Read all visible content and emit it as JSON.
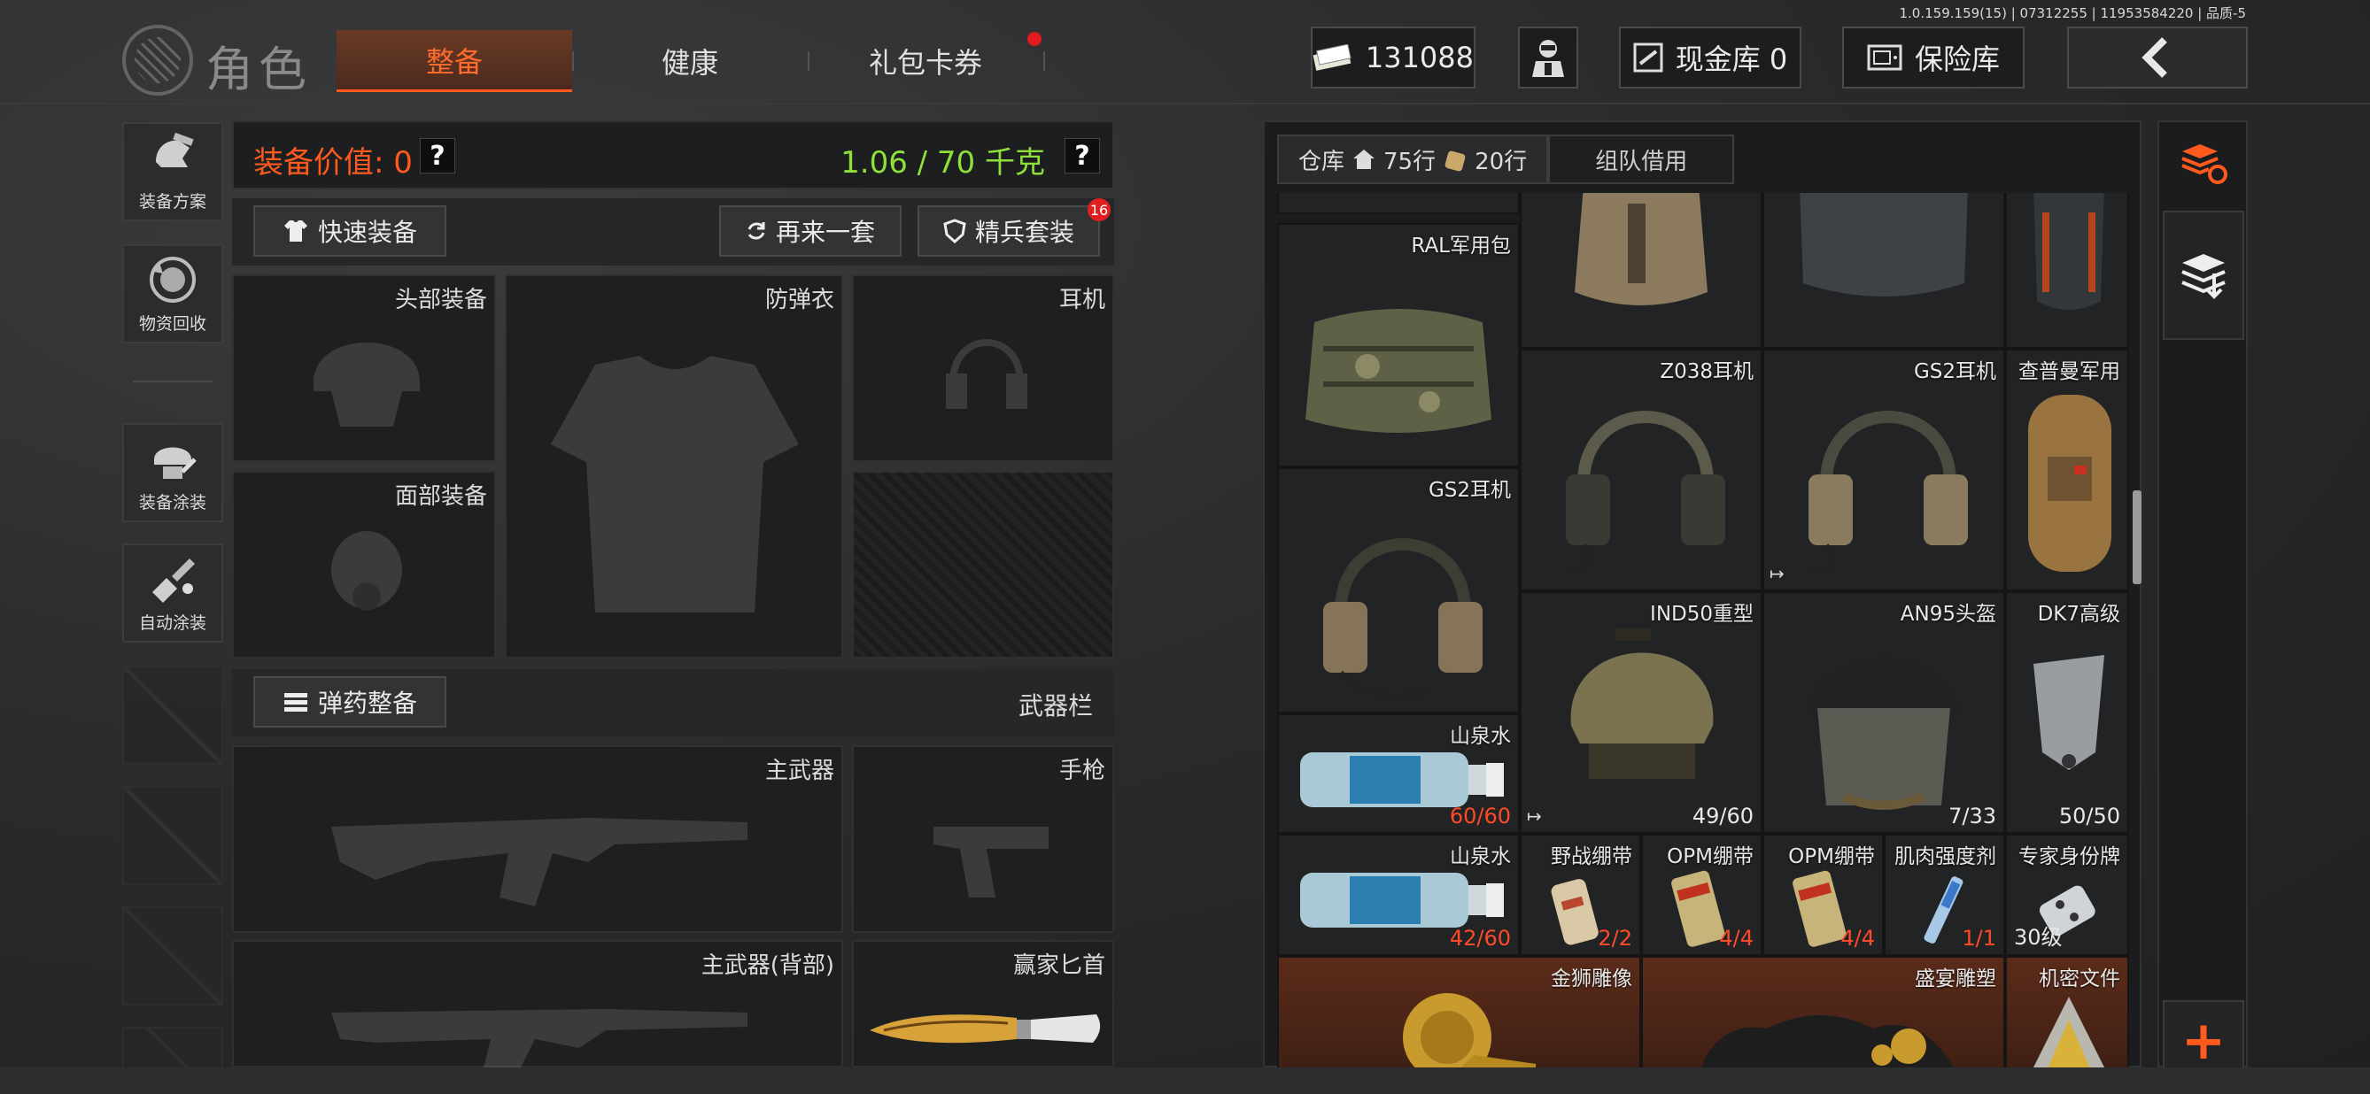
{
  "version": "1.0.159.159(15) | 07312255 | 11953584220 | 品质-5",
  "header": {
    "title": "角色",
    "tabs": [
      {
        "label": "整备",
        "active": true
      },
      {
        "label": "健康",
        "active": false
      },
      {
        "label": "礼包卡券",
        "active": false,
        "dot": true
      }
    ],
    "money": "131088",
    "cash_vault": "现金库 0",
    "safe": "保险库",
    "back_icon": "chevron-left-icon"
  },
  "sidebar": [
    {
      "label": "装备方案",
      "icon": "gear-plan-icon"
    },
    {
      "label": "物资回收",
      "icon": "recycle-icon"
    },
    {
      "label": "装备涂装",
      "icon": "helmet-paint-icon"
    },
    {
      "label": "自动涂装",
      "icon": "auto-paint-icon"
    }
  ],
  "equipment": {
    "value_label": "装备价值: 0",
    "weight": "1.06 / 70 千克",
    "quick_equip": "快速装备",
    "again": "再来一套",
    "elite": "精兵套装",
    "elite_badge": "16",
    "slots": {
      "head": "头部装备",
      "armor": "防弹衣",
      "headset": "耳机",
      "face": "面部装备",
      "primary": "主武器",
      "pistol": "手枪",
      "primary_back": "主武器(背部)",
      "knife": "赢家匕首"
    },
    "ammo_button": "弹药整备",
    "weapon_bar": "武器栏"
  },
  "warehouse": {
    "tab_label": "仓库",
    "rows_home": "75行",
    "rows_bag": "20行",
    "team_tab": "组队借用",
    "items": [
      {
        "name": "RAL军用包",
        "count": ""
      },
      {
        "name": "Z038耳机",
        "count": ""
      },
      {
        "name": "GS2耳机",
        "count": ""
      },
      {
        "name": "查普曼军用",
        "count": ""
      },
      {
        "name": "GS2耳机",
        "count": ""
      },
      {
        "name": "IND50重型",
        "count": "49/60"
      },
      {
        "name": "AN95头盔",
        "count": "7/33"
      },
      {
        "name": "DK7高级",
        "count": "50/50"
      },
      {
        "name": "山泉水",
        "count": "60/60"
      },
      {
        "name": "山泉水",
        "count": "42/60"
      },
      {
        "name": "野战绷带",
        "count": "2/2"
      },
      {
        "name": "OPM绷带",
        "count": "4/4"
      },
      {
        "name": "OPM绷带",
        "count": "4/4"
      },
      {
        "name": "肌肉强度剂",
        "count": "1/1"
      },
      {
        "name": "专家身份牌",
        "count": "30级"
      },
      {
        "name": "金狮雕像",
        "count": ""
      },
      {
        "name": "盛宴雕塑",
        "count": ""
      },
      {
        "name": "机密文件",
        "count": ""
      }
    ]
  },
  "colors": {
    "accent": "#ff5a1e",
    "weight_green": "#8fe03a",
    "count_red": "#ff4a2a"
  }
}
